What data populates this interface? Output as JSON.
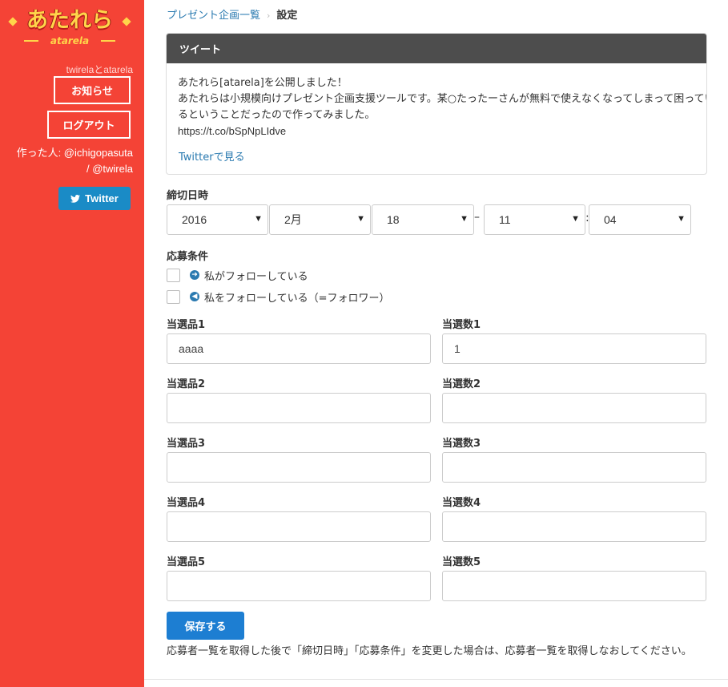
{
  "sidebar": {
    "logo_main": "あたれら",
    "logo_sub": "atarela",
    "caption": "twirelaとatarela",
    "notice_label": "お知らせ",
    "logout_label": "ログアウト",
    "maker_line1": "作った人: @ichigopasuta",
    "maker_line2": "/ @twirela",
    "twitter_label": "Twitter",
    "bg_color": "#f44336"
  },
  "breadcrumb": {
    "link": "プレゼント企画一覧",
    "separator": "›",
    "current": "設定"
  },
  "tweet_panel": {
    "title": "ツイート",
    "line1": "あたれら[atarela]を公開しました！",
    "line2": "あたれらは小規模向けプレゼント企画支援ツールです。某○たったーさんが無料で使えなくなってしまって困ってい",
    "line3": "るということだったので作ってみました。",
    "url": "https://t.co/bSpNpLIdve",
    "view_link": "Twitterで見る"
  },
  "deadline": {
    "label": "締切日時",
    "year": "2016",
    "month": "2月",
    "day": "18",
    "dash": "–",
    "hour": "11",
    "colon": ":",
    "minute": "04",
    "caret": "▼"
  },
  "conditions": {
    "label": "応募条件",
    "option1": "私がフォローしている",
    "option2": "私をフォローしている（=フォロワー）",
    "option1_checked": false,
    "option2_checked": false
  },
  "prizes": [
    {
      "prize_label": "当選品1",
      "prize_value": "aaaa",
      "count_label": "当選数1",
      "count_value": "1"
    },
    {
      "prize_label": "当選品2",
      "prize_value": "",
      "count_label": "当選数2",
      "count_value": ""
    },
    {
      "prize_label": "当選品3",
      "prize_value": "",
      "count_label": "当選数3",
      "count_value": ""
    },
    {
      "prize_label": "当選品4",
      "prize_value": "",
      "count_label": "当選数4",
      "count_value": ""
    },
    {
      "prize_label": "当選品5",
      "prize_value": "",
      "count_label": "当選数5",
      "count_value": ""
    }
  ],
  "save_label": "保存する",
  "note": "応募者一覧を取得した後で「締切日時」「応募条件」を変更した場合は、応募者一覧を取得しなおしてください。",
  "colors": {
    "accent_blue": "#1d7ed2",
    "link_blue": "#2a7ab0",
    "panel_header": "#4d4d4d",
    "twitter_blue": "#1a8bc6"
  },
  "icons": {
    "twitter": "twitter-bird-icon",
    "follow_out": "arrow-right-circle-icon",
    "follow_in": "arrow-left-circle-icon",
    "caret": "caret-down-icon"
  }
}
